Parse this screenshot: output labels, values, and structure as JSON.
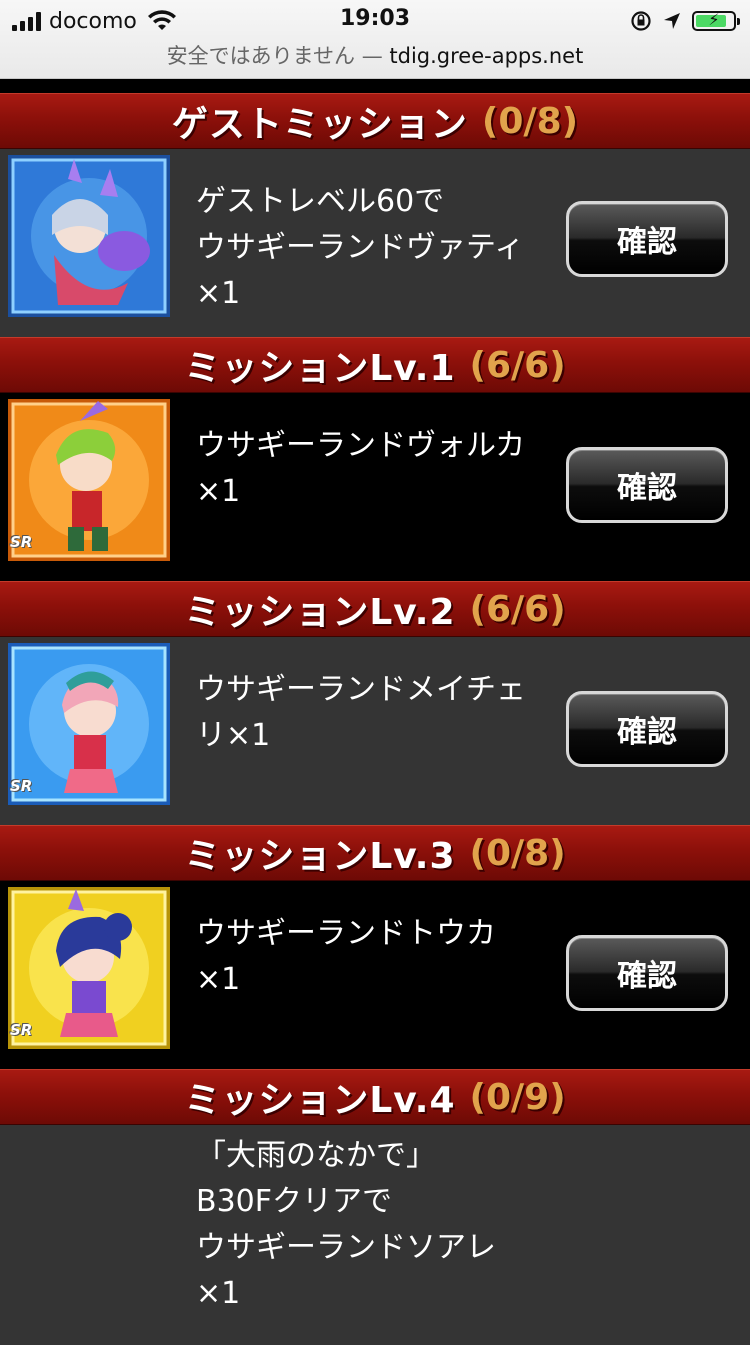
{
  "status_bar": {
    "carrier": "docomo",
    "time": "19:03",
    "url_warning": "安全ではありません —",
    "url_host": "tdig.gree-apps.net"
  },
  "sections": [
    {
      "title": "ゲストミッション",
      "count": "(0/8)",
      "lines": [
        "ゲストレベル60で",
        "ウサギーランドヴァティ",
        "×1"
      ],
      "button": "確認",
      "rarity": "",
      "frame_color": "#2a6bd0"
    },
    {
      "title": "ミッションLv.1",
      "count": "(6/6)",
      "lines": [
        "ウサギーランドヴォルカ",
        "×1"
      ],
      "button": "確認",
      "rarity": "SR",
      "frame_color": "#f07a12"
    },
    {
      "title": "ミッションLv.2",
      "count": "(6/6)",
      "lines": [
        "ウサギーランドメイチェ",
        "リ×1"
      ],
      "button": "確認",
      "rarity": "SR",
      "frame_color": "#2f8be8"
    },
    {
      "title": "ミッションLv.3",
      "count": "(0/8)",
      "lines": [
        "ウサギーランドトウカ",
        "×1"
      ],
      "button": "確認",
      "rarity": "SR",
      "frame_color": "#e0c21a"
    },
    {
      "title": "ミッションLv.4",
      "count": "(0/9)",
      "lines": [
        "「大雨のなかで」",
        "B30Fクリアで",
        "ウサギーランドソアレ",
        "×1"
      ]
    }
  ]
}
